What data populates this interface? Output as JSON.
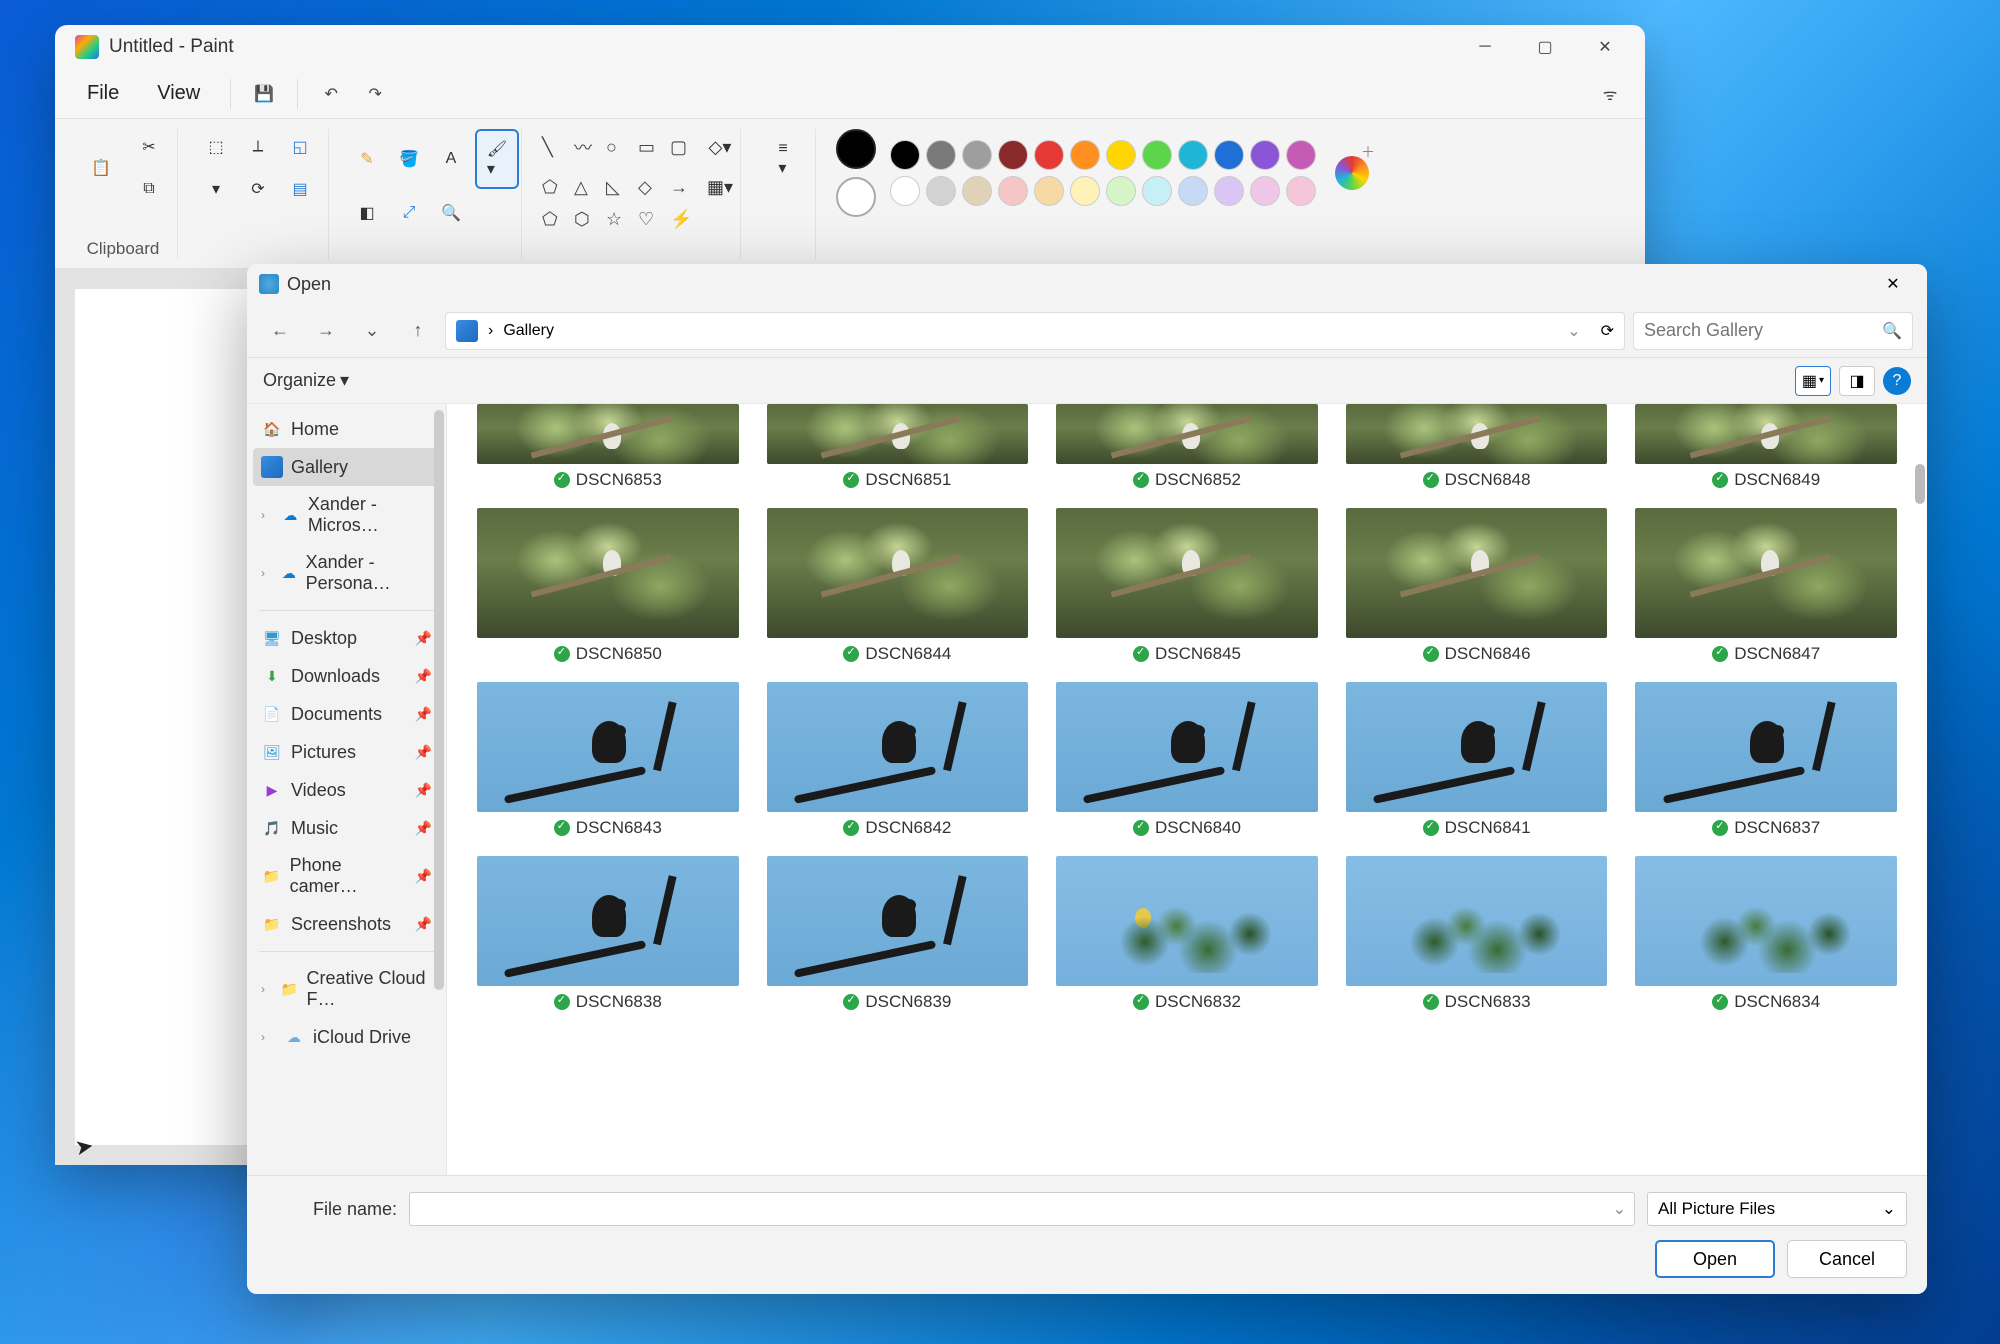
{
  "paint": {
    "title": "Untitled - Paint",
    "menu": {
      "file": "File",
      "view": "View"
    },
    "clipboard_label": "Clipboard"
  },
  "colors_row1": [
    "#000000",
    "#7a7a7a",
    "#9e9e9e",
    "#8a2a2a",
    "#e53935",
    "#ff8f1f",
    "#ffd600",
    "#5bd64a",
    "#1fb5d6",
    "#1f6fd6",
    "#8a55d6",
    "#c55bb4"
  ],
  "colors_row2": [
    "#ffffff",
    "#d2d2d2",
    "#e0d2b8",
    "#f5c6c6",
    "#f7d9a6",
    "#fff2b8",
    "#d6f5c6",
    "#c6f0f5",
    "#c6d9f5",
    "#d9c6f5",
    "#f0c6e8",
    "#f5c6d9"
  ],
  "dialog": {
    "title": "Open",
    "breadcrumb": "Gallery",
    "search_placeholder": "Search Gallery",
    "organize": "Organize",
    "sidebar": {
      "home": "Home",
      "gallery": "Gallery",
      "cloud1": "Xander - Micros…",
      "cloud2": "Xander - Persona…",
      "desktop": "Desktop",
      "downloads": "Downloads",
      "documents": "Documents",
      "pictures": "Pictures",
      "videos": "Videos",
      "music": "Music",
      "phone": "Phone camer…",
      "screenshots": "Screenshots",
      "ccf": "Creative Cloud F…",
      "icloud": "iCloud Drive"
    },
    "thumbs": [
      {
        "n": "DSCN6853",
        "s": "tree"
      },
      {
        "n": "DSCN6851",
        "s": "tree"
      },
      {
        "n": "DSCN6852",
        "s": "tree"
      },
      {
        "n": "DSCN6848",
        "s": "tree"
      },
      {
        "n": "DSCN6849",
        "s": "tree"
      },
      {
        "n": "DSCN6850",
        "s": "tree"
      },
      {
        "n": "DSCN6844",
        "s": "tree"
      },
      {
        "n": "DSCN6845",
        "s": "tree"
      },
      {
        "n": "DSCN6846",
        "s": "tree"
      },
      {
        "n": "DSCN6847",
        "s": "tree"
      },
      {
        "n": "DSCN6843",
        "s": "sky"
      },
      {
        "n": "DSCN6842",
        "s": "sky"
      },
      {
        "n": "DSCN6840",
        "s": "sky"
      },
      {
        "n": "DSCN6841",
        "s": "sky"
      },
      {
        "n": "DSCN6837",
        "s": "sky"
      },
      {
        "n": "DSCN6838",
        "s": "sky"
      },
      {
        "n": "DSCN6839",
        "s": "sky"
      },
      {
        "n": "DSCN6832",
        "s": "foliage"
      },
      {
        "n": "DSCN6833",
        "s": "foliage"
      },
      {
        "n": "DSCN6834",
        "s": "foliage"
      }
    ],
    "file_name_label": "File name:",
    "filter": "All Picture Files",
    "open": "Open",
    "cancel": "Cancel"
  }
}
